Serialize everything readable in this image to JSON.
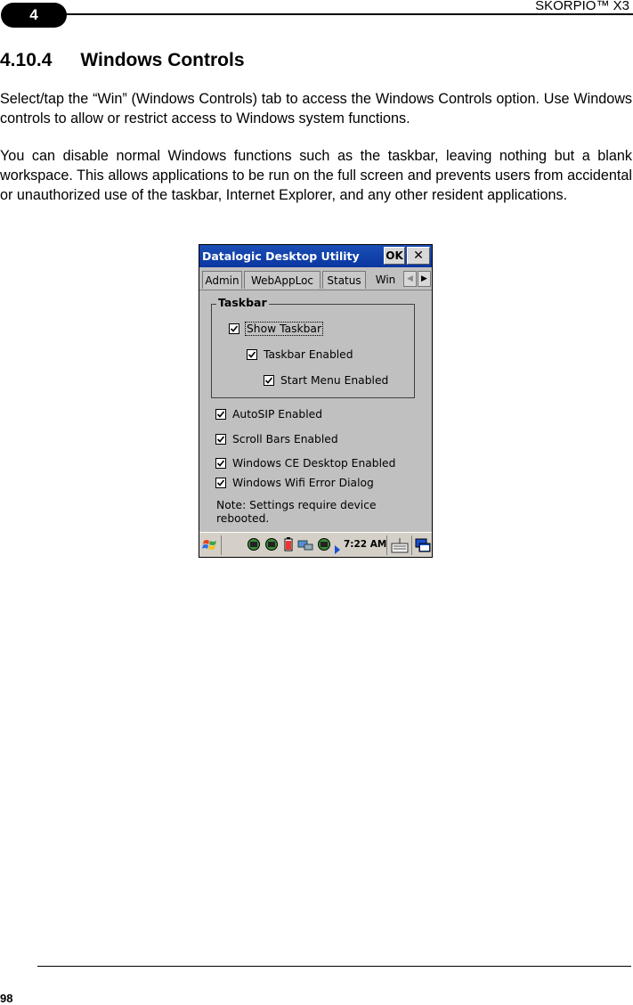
{
  "header": {
    "chapter": "4",
    "product": "SKORPIO™ X3"
  },
  "section": {
    "number": "4.10.4",
    "title": "Windows Controls"
  },
  "paragraphs": [
    "Select/tap the “Win” (Windows Controls) tab to access the Windows Controls option. Use Windows controls to allow or restrict access to Windows system functions.",
    "You can disable normal Windows functions such as the taskbar, leaving nothing but a blank workspace. This allows applications to be run on the full screen and prevents users from accidental or unauthorized use of the taskbar, Internet Explorer, and any other resident applications."
  ],
  "device": {
    "window_title": "Datalogic Desktop Utility",
    "ok_label": "OK",
    "close_label": "✕",
    "tabs": [
      "Admin",
      "WebAppLoc",
      "Status",
      "Win"
    ],
    "active_tab": "Win",
    "group_title": "Taskbar",
    "taskbar_options": [
      {
        "label": "Show Taskbar",
        "checked": true
      },
      {
        "label": "Taskbar Enabled",
        "checked": true
      },
      {
        "label": "Start Menu Enabled",
        "checked": true
      }
    ],
    "options": [
      {
        "label": "AutoSIP Enabled",
        "checked": true
      },
      {
        "label": "Scroll Bars Enabled",
        "checked": true
      },
      {
        "label": "Windows CE Desktop Enabled",
        "checked": true
      },
      {
        "label": "Windows Wifi Error Dialog",
        "checked": true
      }
    ],
    "note": "Note: Settings require device rebooted.",
    "taskbar_time": "7:22 AM",
    "icons": [
      "windows-start-icon",
      "network-icon",
      "battery-icon",
      "connection-icon",
      "keyboard-icon",
      "desktop-icon"
    ],
    "colors": {
      "titlebar": "#0a36a0",
      "window_bg": "#c0c0c0"
    }
  },
  "footer": {
    "page_number": "98"
  }
}
